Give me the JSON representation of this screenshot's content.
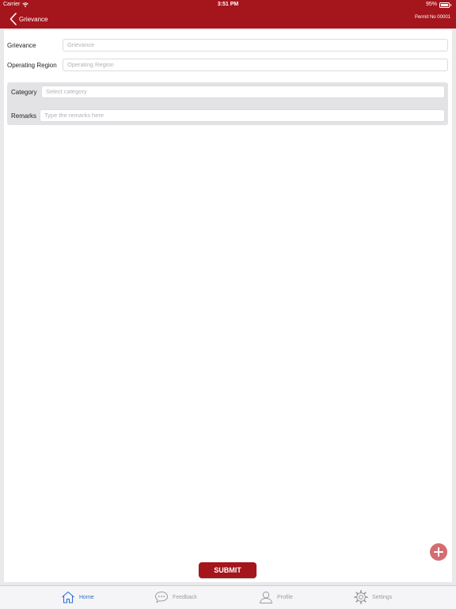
{
  "status_bar": {
    "carrier": "Carrier",
    "time": "3:51 PM",
    "battery": "95%",
    "battery_level": 0.95
  },
  "nav": {
    "back_title": "Grievance",
    "permit": "Permit No 00001"
  },
  "form": {
    "grievance": {
      "label": "Grievance",
      "placeholder": "Grievance"
    },
    "region": {
      "label": "Operating Region",
      "placeholder": "Operating Region"
    },
    "category": {
      "label": "Category",
      "placeholder": "Select category"
    },
    "remarks": {
      "label": "Remarks",
      "placeholder": "Type the remarks here"
    }
  },
  "actions": {
    "submit": "SUBMIT",
    "add_icon": "plus-icon"
  },
  "tabs": [
    {
      "label": "Home",
      "icon": "home-icon",
      "active": true
    },
    {
      "label": "Feedback",
      "icon": "chat-bubble-icon",
      "active": false
    },
    {
      "label": "Profile",
      "icon": "profile-icon",
      "active": false
    },
    {
      "label": "Settings",
      "icon": "gear-icon",
      "active": false
    }
  ],
  "colors": {
    "brand": "#a5151c",
    "tab_active": "#2f6fd6",
    "tab_inactive": "#9c9ca1",
    "fab": "#d36d71"
  }
}
